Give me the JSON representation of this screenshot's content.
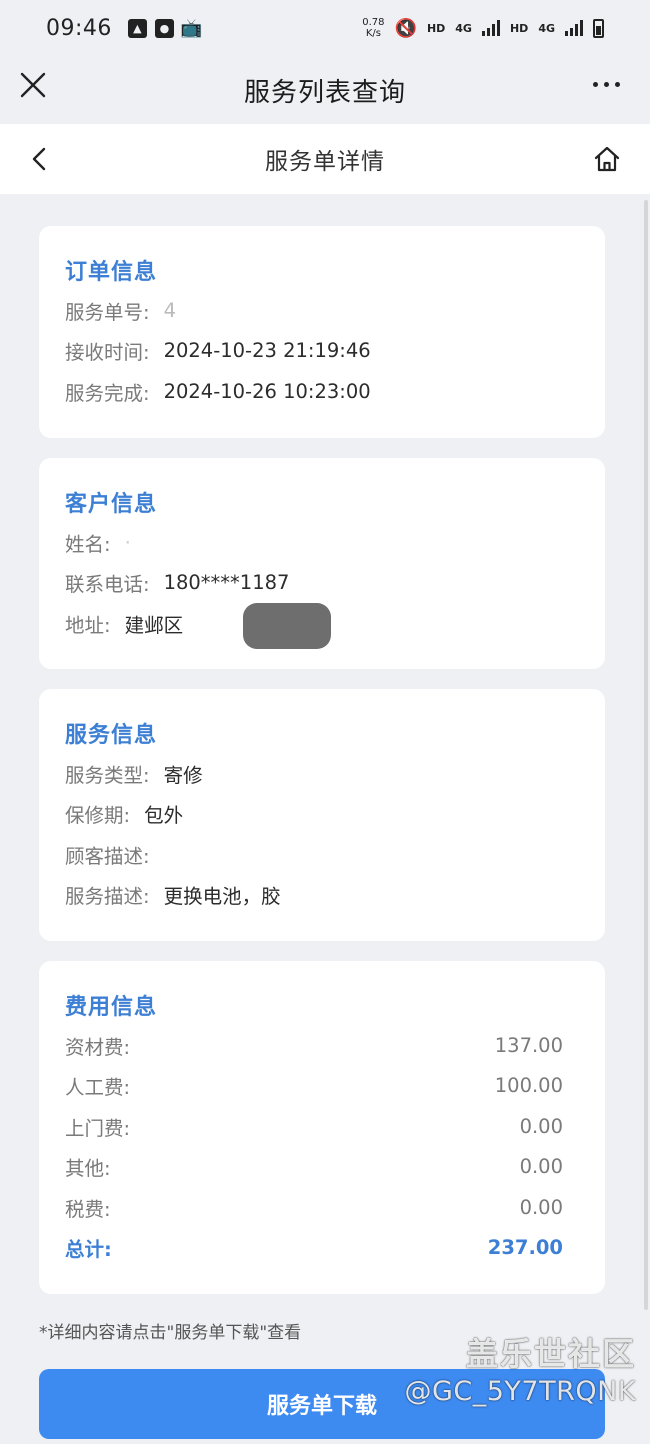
{
  "status_bar": {
    "time": "09:46",
    "net_speed_value": "0.78",
    "net_speed_unit": "K/s",
    "hd_label": "HD",
    "network_4g": "4G"
  },
  "app_bar": {
    "title": "服务列表查询"
  },
  "sub_header": {
    "title": "服务单详情"
  },
  "order_info": {
    "title": "订单信息",
    "service_no_label": "服务单号:",
    "service_no_value": "4",
    "received_label": "接收时间:",
    "received_value": "2024-10-23 21:19:46",
    "completed_label": "服务完成:",
    "completed_value": "2024-10-26 10:23:00"
  },
  "customer_info": {
    "title": "客户信息",
    "name_label": "姓名:",
    "phone_label": "联系电话:",
    "phone_value": "180****1187",
    "address_label": "地址:",
    "address_value": "建邺区"
  },
  "service_info": {
    "title": "服务信息",
    "type_label": "服务类型:",
    "type_value": "寄修",
    "warranty_label": "保修期:",
    "warranty_value": "包外",
    "customer_desc_label": "顾客描述:",
    "customer_desc_value": "",
    "service_desc_label": "服务描述:",
    "service_desc_value": "更换电池，胶"
  },
  "fee_info": {
    "title": "费用信息",
    "rows": [
      {
        "label": "资材费:",
        "amount": "137.00"
      },
      {
        "label": "人工费:",
        "amount": "100.00"
      },
      {
        "label": "上门费:",
        "amount": "0.00"
      },
      {
        "label": "其他:",
        "amount": "0.00"
      },
      {
        "label": "税费:",
        "amount": "0.00"
      }
    ],
    "total_label": "总计:",
    "total_amount": "237.00"
  },
  "footnote": "*详细内容请点击\"服务单下载\"查看",
  "download_button": {
    "label": "服务单下载"
  },
  "watermark": {
    "line1": "盖乐世社区",
    "line2": "@GC_5Y7TRQNK"
  },
  "colors": {
    "accent": "#3d7fd4",
    "button": "#3d8af0",
    "background": "#eef0f4"
  }
}
